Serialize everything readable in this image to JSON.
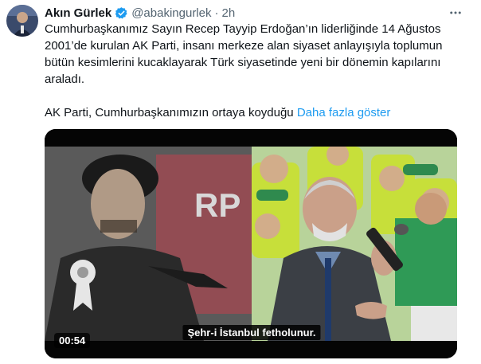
{
  "author": {
    "name": "Akın Gürlek",
    "handle": "@abakingurlek",
    "separator": "·",
    "time": "2h",
    "verified_color": "#1d9bf0"
  },
  "tweet": {
    "paragraph1": "Cumhurbaşkanımız Sayın Recep Tayyip Erdoğan’ın liderliğinde 14 Ağustos 2001’de kurulan AK Parti, insanı merkeze alan siyaset anlayışıyla toplumun bütün kesimlerini kucaklayarak Türk siyasetinde yeni bir dönemin kapılarını araladı.",
    "paragraph2": "AK Parti, Cumhurbaşkanımızın ortaya koyduğu",
    "show_more": "Daha fazla göster"
  },
  "video": {
    "subtitle": "Şehr-i İstanbul fetholunur.",
    "duration": "00:54",
    "poster_text": "RP"
  },
  "icons": {
    "verified": "verified-badge-icon",
    "more": "more-dots-icon"
  }
}
